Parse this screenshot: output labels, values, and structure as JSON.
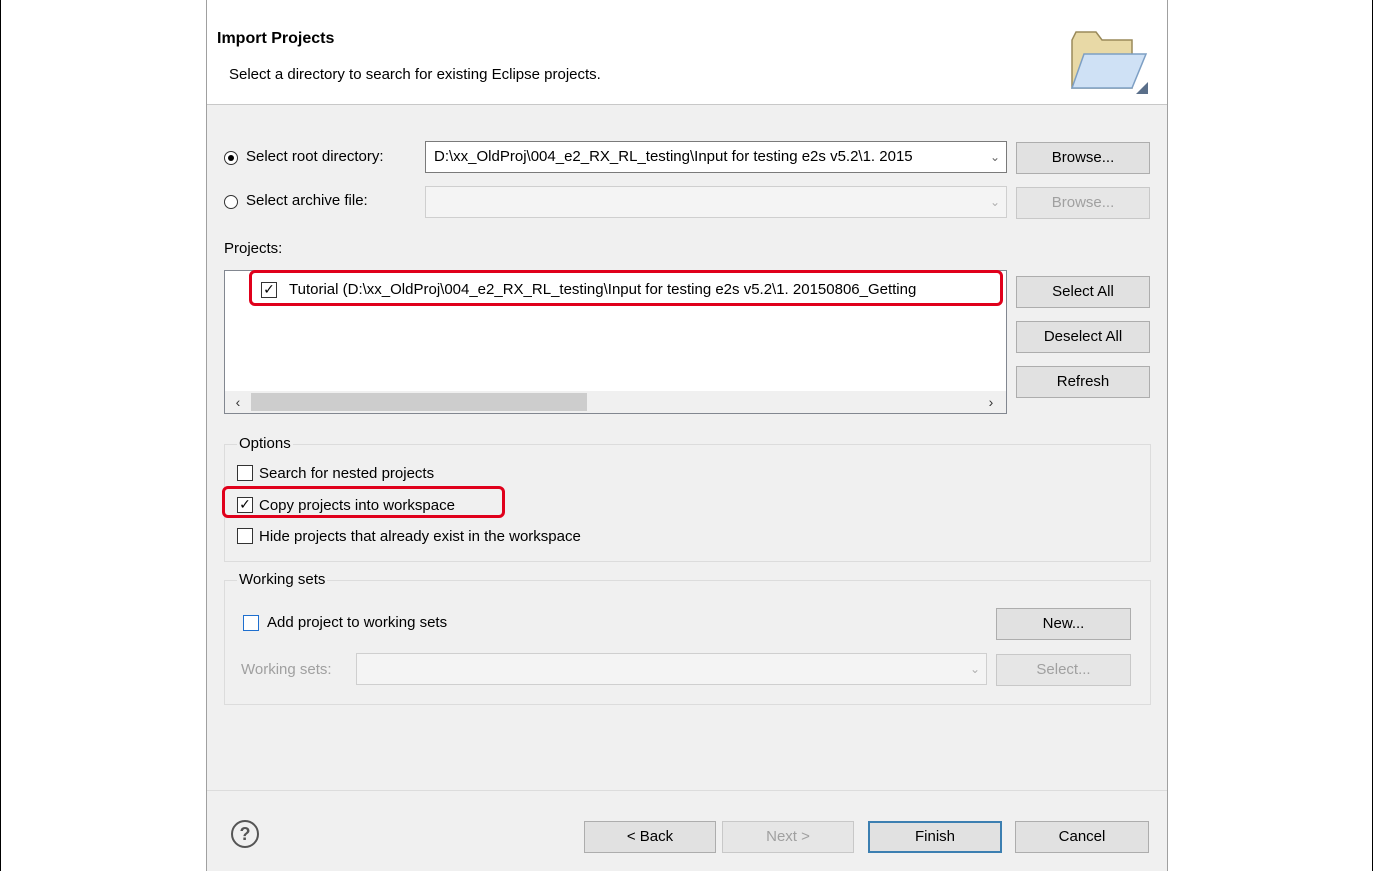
{
  "header": {
    "title": "Import Projects",
    "description": "Select a directory to search for existing Eclipse projects."
  },
  "source": {
    "root_label": "Select root directory:",
    "root_value": "D:\\xx_OldProj\\004_e2_RX_RL_testing\\Input for testing e2s v5.2\\1. 2015",
    "root_selected": true,
    "archive_label": "Select archive file:",
    "archive_value": "",
    "archive_selected": false,
    "browse_label": "Browse...",
    "browse_archive_label": "Browse..."
  },
  "projects": {
    "label": "Projects:",
    "items": [
      {
        "checked": true,
        "text": "Tutorial (D:\\xx_OldProj\\004_e2_RX_RL_testing\\Input for testing e2s v5.2\\1. 20150806_Getting"
      }
    ],
    "select_all": "Select All",
    "deselect_all": "Deselect All",
    "refresh": "Refresh"
  },
  "options": {
    "title": "Options",
    "search_nested": {
      "label": "Search for nested projects",
      "checked": false
    },
    "copy_into_workspace": {
      "label": "Copy projects into workspace",
      "checked": true
    },
    "hide_existing": {
      "label": "Hide projects that already exist in the workspace",
      "checked": false
    }
  },
  "working_sets": {
    "title": "Working sets",
    "add_label": "Add project to working sets",
    "add_checked": false,
    "new_button": "New...",
    "sets_label": "Working sets:",
    "sets_value": "",
    "select_button": "Select..."
  },
  "footer": {
    "back": "< Back",
    "next": "Next >",
    "finish": "Finish",
    "cancel": "Cancel"
  }
}
